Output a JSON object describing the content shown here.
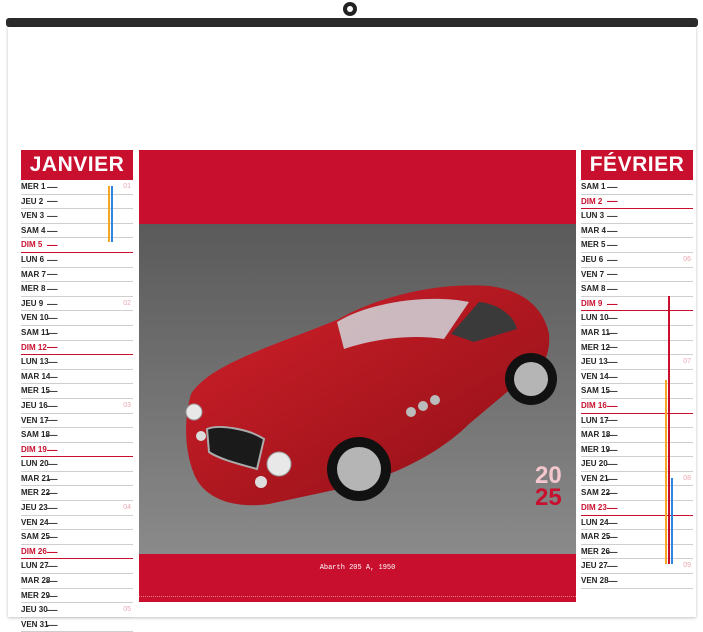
{
  "photo": {
    "caption": "Abarth 205 A, 1950"
  },
  "year": {
    "line1": "20",
    "line2": "25"
  },
  "january": {
    "name": "JANVIER",
    "days": [
      {
        "label": "MER 1",
        "sunday": false,
        "week": "01"
      },
      {
        "label": "JEU 2",
        "sunday": false,
        "week": ""
      },
      {
        "label": "VEN 3",
        "sunday": false,
        "week": ""
      },
      {
        "label": "SAM 4",
        "sunday": false,
        "week": ""
      },
      {
        "label": "DIM 5",
        "sunday": true,
        "week": ""
      },
      {
        "label": "LUN 6",
        "sunday": false,
        "week": ""
      },
      {
        "label": "MAR 7",
        "sunday": false,
        "week": ""
      },
      {
        "label": "MER 8",
        "sunday": false,
        "week": ""
      },
      {
        "label": "JEU 9",
        "sunday": false,
        "week": "02"
      },
      {
        "label": "VEN 10",
        "sunday": false,
        "week": ""
      },
      {
        "label": "SAM 11",
        "sunday": false,
        "week": ""
      },
      {
        "label": "DIM 12",
        "sunday": true,
        "week": ""
      },
      {
        "label": "LUN 13",
        "sunday": false,
        "week": ""
      },
      {
        "label": "MAR 14",
        "sunday": false,
        "week": ""
      },
      {
        "label": "MER 15",
        "sunday": false,
        "week": ""
      },
      {
        "label": "JEU 16",
        "sunday": false,
        "week": "03"
      },
      {
        "label": "VEN 17",
        "sunday": false,
        "week": ""
      },
      {
        "label": "SAM 18",
        "sunday": false,
        "week": ""
      },
      {
        "label": "DIM 19",
        "sunday": true,
        "week": ""
      },
      {
        "label": "LUN 20",
        "sunday": false,
        "week": ""
      },
      {
        "label": "MAR 21",
        "sunday": false,
        "week": ""
      },
      {
        "label": "MER 22",
        "sunday": false,
        "week": ""
      },
      {
        "label": "JEU 23",
        "sunday": false,
        "week": "04"
      },
      {
        "label": "VEN 24",
        "sunday": false,
        "week": ""
      },
      {
        "label": "SAM 25",
        "sunday": false,
        "week": ""
      },
      {
        "label": "DIM 26",
        "sunday": true,
        "week": ""
      },
      {
        "label": "LUN 27",
        "sunday": false,
        "week": ""
      },
      {
        "label": "MAR 28",
        "sunday": false,
        "week": ""
      },
      {
        "label": "MER 29",
        "sunday": false,
        "week": ""
      },
      {
        "label": "JEU 30",
        "sunday": false,
        "week": "05"
      },
      {
        "label": "VEN 31",
        "sunday": false,
        "week": ""
      }
    ]
  },
  "february": {
    "name": "FÉVRIER",
    "days": [
      {
        "label": "SAM 1",
        "sunday": false,
        "week": ""
      },
      {
        "label": "DIM 2",
        "sunday": true,
        "week": ""
      },
      {
        "label": "LUN 3",
        "sunday": false,
        "week": ""
      },
      {
        "label": "MAR 4",
        "sunday": false,
        "week": ""
      },
      {
        "label": "MER 5",
        "sunday": false,
        "week": ""
      },
      {
        "label": "JEU 6",
        "sunday": false,
        "week": "06"
      },
      {
        "label": "VEN 7",
        "sunday": false,
        "week": ""
      },
      {
        "label": "SAM 8",
        "sunday": false,
        "week": ""
      },
      {
        "label": "DIM 9",
        "sunday": true,
        "week": ""
      },
      {
        "label": "LUN 10",
        "sunday": false,
        "week": ""
      },
      {
        "label": "MAR 11",
        "sunday": false,
        "week": ""
      },
      {
        "label": "MER 12",
        "sunday": false,
        "week": ""
      },
      {
        "label": "JEU 13",
        "sunday": false,
        "week": "07"
      },
      {
        "label": "VEN 14",
        "sunday": false,
        "week": ""
      },
      {
        "label": "SAM 15",
        "sunday": false,
        "week": ""
      },
      {
        "label": "DIM 16",
        "sunday": true,
        "week": ""
      },
      {
        "label": "LUN 17",
        "sunday": false,
        "week": ""
      },
      {
        "label": "MAR 18",
        "sunday": false,
        "week": ""
      },
      {
        "label": "MER 19",
        "sunday": false,
        "week": ""
      },
      {
        "label": "JEU 20",
        "sunday": false,
        "week": ""
      },
      {
        "label": "VEN 21",
        "sunday": false,
        "week": "08"
      },
      {
        "label": "SAM 22",
        "sunday": false,
        "week": ""
      },
      {
        "label": "DIM 23",
        "sunday": true,
        "week": ""
      },
      {
        "label": "LUN 24",
        "sunday": false,
        "week": ""
      },
      {
        "label": "MAR 25",
        "sunday": false,
        "week": ""
      },
      {
        "label": "MER 26",
        "sunday": false,
        "week": ""
      },
      {
        "label": "JEU 27",
        "sunday": false,
        "week": "09"
      },
      {
        "label": "VEN 28",
        "sunday": false,
        "week": ""
      }
    ]
  },
  "colors": {
    "accent": "#c8102e",
    "school_orange": "#f5a623",
    "school_blue": "#2e86de",
    "school_red": "#c8102e"
  }
}
